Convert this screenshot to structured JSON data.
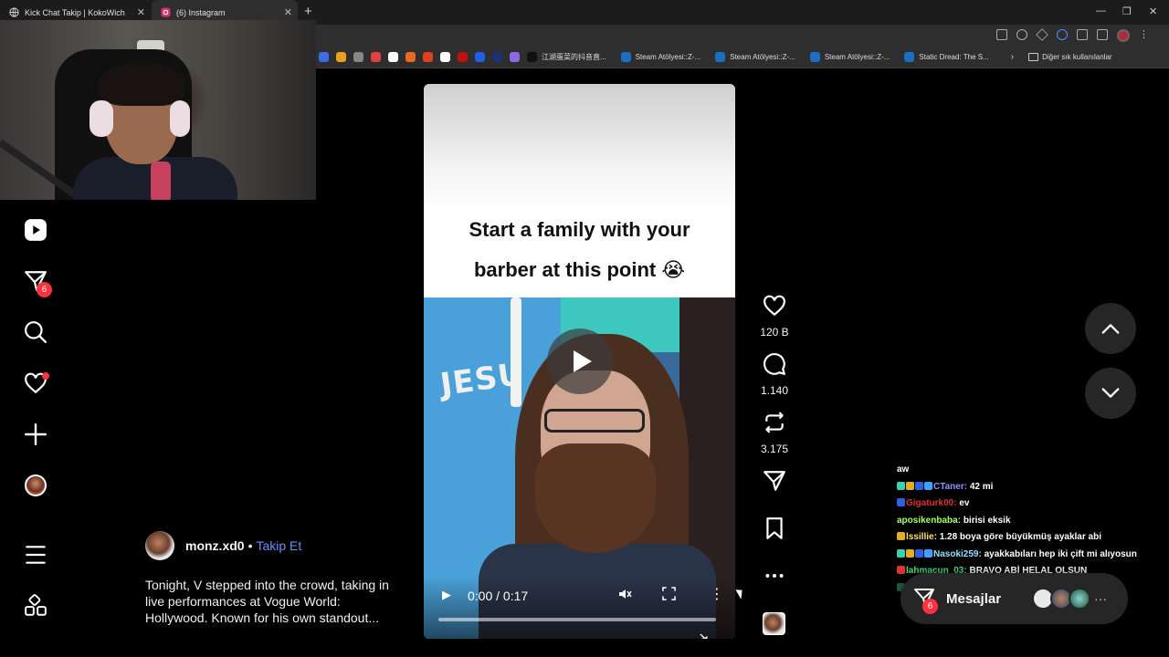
{
  "browser": {
    "tabs": [
      {
        "title": "Kick Chat Takip | KokoWich",
        "active": false
      },
      {
        "title": "(6) Instagram",
        "active": true
      }
    ],
    "new_tab": "+",
    "window_controls": {
      "minimize": "—",
      "maximize": "❐",
      "close": "✕"
    },
    "bookmarks": [
      {
        "label": "江湖蛋菜的抖音直...",
        "color": "#111111"
      },
      {
        "label": "Steam Atölyesi::Z-...",
        "color": "#1b6ec2"
      },
      {
        "label": "Steam Atölyesi::Z-...",
        "color": "#1b6ec2"
      },
      {
        "label": "Steam Atölyesi::Z-...",
        "color": "#1b6ec2"
      },
      {
        "label": "Static Dread: The S...",
        "color": "#1b6ec2"
      }
    ],
    "bookmark_icon_colors": [
      "#3a6ee8",
      "#e8a020",
      "#888888",
      "#e04040",
      "#ffffff",
      "#e86a20",
      "#e04020",
      "#ffffff",
      "#c01010",
      "#2060e0",
      "#203070",
      "#8a6ae0"
    ],
    "bookmarks_more": "›",
    "other_bookmarks": "Diğer sık kullanılanlar"
  },
  "sidebar": {
    "items": [
      {
        "name": "reels",
        "icon": "reels-icon"
      },
      {
        "name": "messages",
        "icon": "messages-icon",
        "badge": "6"
      },
      {
        "name": "search",
        "icon": "search-icon"
      },
      {
        "name": "notifications",
        "icon": "heart-icon"
      },
      {
        "name": "create",
        "icon": "plus-icon"
      },
      {
        "name": "profile",
        "icon": "avatar"
      },
      {
        "name": "more",
        "icon": "menu-icon"
      },
      {
        "name": "also-from-meta",
        "icon": "grid-icon"
      }
    ]
  },
  "post": {
    "author": "monz.xd0",
    "separator": "•",
    "follow": "Takip Et",
    "caption": [
      "Tonight, V stepped into the crowd, taking in",
      "live performances at Vogue World:",
      "Hollywood. Known for his own standout..."
    ]
  },
  "video": {
    "title_lines": [
      "Start a family with your",
      "barber at this point 😭"
    ],
    "scene_text": "JESU",
    "time": "0:00 / 0:17",
    "progress": 0,
    "colors": {
      "accent": "#6c8cff",
      "badge": "#ff3040"
    }
  },
  "actions": {
    "likes": "120 B",
    "comments": "1.140",
    "reposts": "3.175"
  },
  "chat": {
    "lines": [
      {
        "user": "",
        "user_color": "#ffffff",
        "text": "aw",
        "badges": []
      },
      {
        "user": "CTaner:",
        "user_color": "#8f8fff",
        "text": "42 mi",
        "badges": [
          "#3ad0b0",
          "#e0b020",
          "#3060e0",
          "#40a0ff"
        ]
      },
      {
        "user": "Gigaturk00:",
        "user_color": "#e03030",
        "text": "ev",
        "badges": [
          "#3060e0"
        ]
      },
      {
        "user": "aposikenbaba:",
        "user_color": "#a8ff60",
        "text": "birisi eksik",
        "badges": []
      },
      {
        "user": "lssillie:",
        "user_color": "#ffe060",
        "text": "1.28 boya göre büyükmüş ayaklar abi",
        "badges": [
          "#e0b020"
        ]
      },
      {
        "user": "Nasoki259:",
        "user_color": "#8fe0ff",
        "text": "ayakkabıları hep iki çift mi alıyosun",
        "badges": [
          "#3ad0b0",
          "#e0b020",
          "#3060e0",
          "#40a0ff"
        ]
      },
      {
        "user": "lahmacun_03:",
        "user_color": "#40e080",
        "text": "BRAVO ABİ HELAL OLSUN",
        "badges": [
          "#e03030"
        ]
      },
      {
        "user": "CTaner:",
        "user_color": "#8f8fff",
        "text": "130 boya çok la 42",
        "badges": [
          "#3ad0b0",
          "#e0b020",
          "#3060e0",
          "#40a0ff"
        ]
      }
    ]
  },
  "messages_bar": {
    "label": "Mesajlar",
    "badge": "6",
    "more": "···"
  }
}
